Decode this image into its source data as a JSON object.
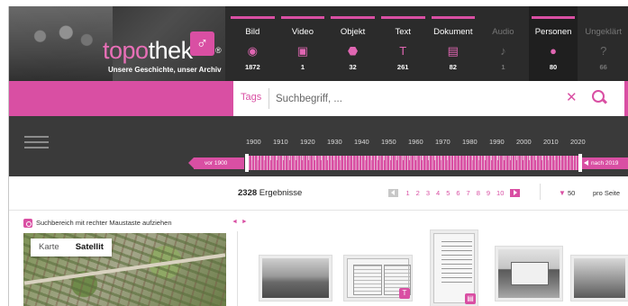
{
  "header": {
    "brand_prefix": "topo",
    "brand_suffix": "thek",
    "brand_mark_glyph": "♂",
    "reg_mark": "®",
    "tagline": "Unsere Geschichte, unser Archiv",
    "categories": [
      {
        "label": "Bild",
        "icon": "camera-icon",
        "glyph": "◉",
        "count": "1872"
      },
      {
        "label": "Video",
        "icon": "video-icon",
        "glyph": "▣",
        "count": "1"
      },
      {
        "label": "Objekt",
        "icon": "object-icon",
        "glyph": "⬣",
        "count": "32"
      },
      {
        "label": "Text",
        "icon": "text-icon",
        "glyph": "T",
        "count": "261"
      },
      {
        "label": "Dokument",
        "icon": "document-icon",
        "glyph": "▤",
        "count": "82"
      },
      {
        "label": "Audio",
        "icon": "audio-icon",
        "glyph": "♪",
        "count": "1"
      },
      {
        "label": "Personen",
        "icon": "person-icon",
        "glyph": "●",
        "count": "80"
      },
      {
        "label": "Ungeklärt",
        "icon": "question-icon",
        "glyph": "?",
        "count": "66"
      }
    ]
  },
  "search": {
    "tags_label": "Tags",
    "placeholder": "Suchbegriff, ...",
    "clear_glyph": "✕"
  },
  "timeline": {
    "years": [
      "1900",
      "1910",
      "1920",
      "1930",
      "1940",
      "1950",
      "1960",
      "1970",
      "1980",
      "1990",
      "2000",
      "2010",
      "2020"
    ],
    "before_label": "vor 1900",
    "after_label": "nach 2019"
  },
  "results": {
    "count": "2328",
    "count_label": "Ergebnisse",
    "pages": [
      "1",
      "2",
      "3",
      "4",
      "5",
      "6",
      "7",
      "8",
      "9",
      "10"
    ],
    "per_page": "50",
    "per_page_label": "pro Seite"
  },
  "map": {
    "note": "Suchbereich mit rechter Maustaste aufziehen",
    "toggle_map": "Karte",
    "toggle_satellite": "Satellit",
    "collapse_glyphs": "◄ ►"
  },
  "thumbnails": {
    "badge_text": "T",
    "badge_doc": "▤"
  },
  "colors": {
    "accent": "#d94fa3",
    "header_bg": "#2b2b2b",
    "timeline_bg": "#3a3a3a"
  }
}
